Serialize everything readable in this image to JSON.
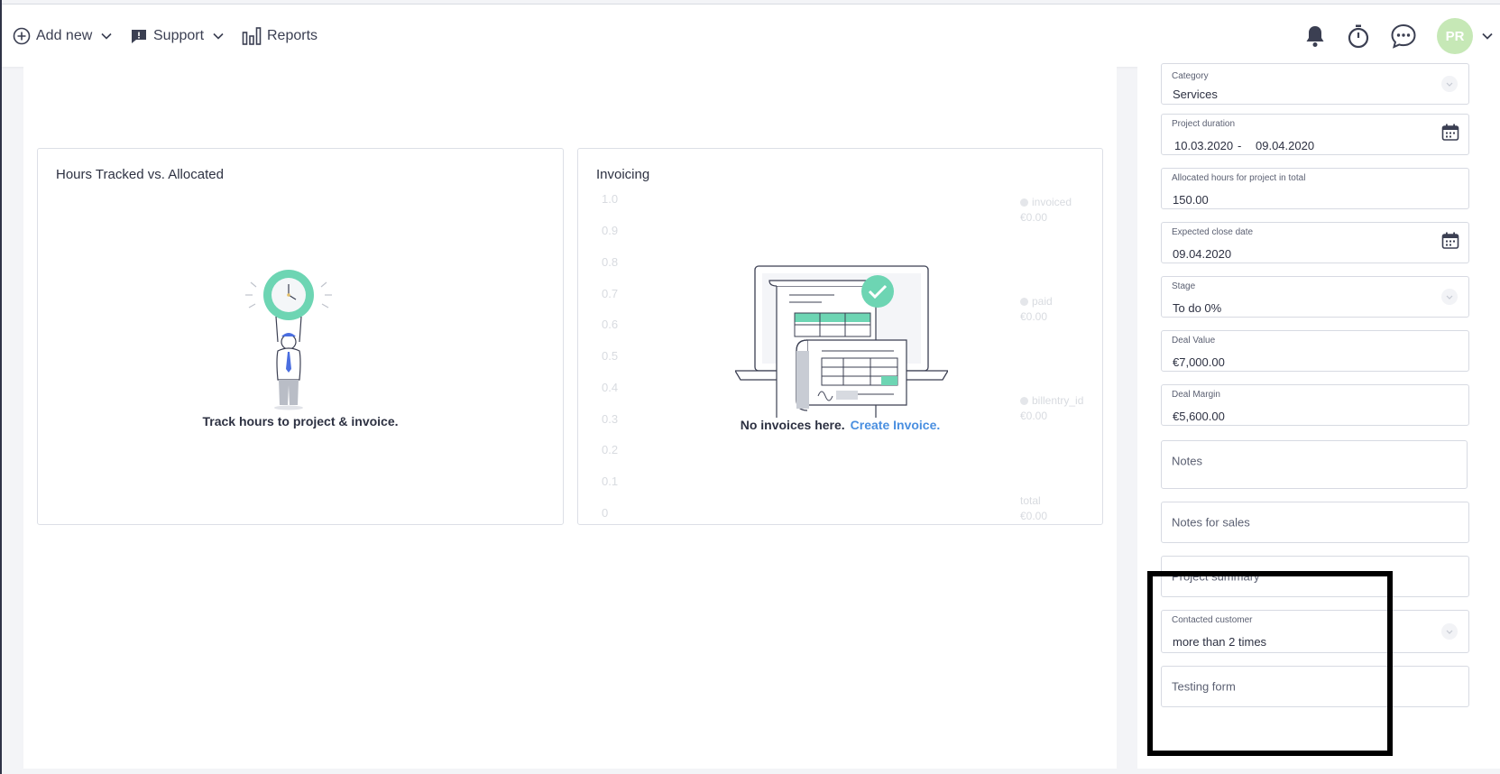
{
  "topbar": {
    "add_new": "Add new",
    "support": "Support",
    "reports": "Reports",
    "avatar_initials": "PR",
    "icons": [
      "plus-circle-icon",
      "chevron-down-icon",
      "support-icon",
      "reports-icon",
      "bell-icon",
      "stopwatch-icon",
      "chat-icon"
    ]
  },
  "cards": {
    "hours": {
      "title": "Hours Tracked vs. Allocated",
      "empty": "Track hours to project & invoice."
    },
    "invoicing": {
      "title": "Invoicing",
      "empty": "No invoices here.",
      "link": "Create Invoice.",
      "ghost_axis": [
        "1.0",
        "0.9",
        "0.8",
        "0.7",
        "0.6",
        "0.5",
        "0.4",
        "0.3",
        "0.2",
        "0.1",
        "0"
      ],
      "ghost_legend": [
        {
          "name": "invoiced",
          "value": "€0.00"
        },
        {
          "name": "paid",
          "value": "€0.00"
        },
        {
          "name": "billentry_id",
          "value": "€0.00"
        },
        {
          "name": "total",
          "value": "€0.00"
        }
      ]
    }
  },
  "sidebar": {
    "category_label": "Category",
    "category_value": "Services",
    "duration_label": "Project duration",
    "duration_start": "10.03.2020",
    "duration_sep": "-",
    "duration_end": "09.04.2020",
    "alloc_label": "Allocated hours for project in total",
    "alloc_value": "150.00",
    "close_label": "Expected close date",
    "close_value": "09.04.2020",
    "stage_label": "Stage",
    "stage_value": "To do 0%",
    "deal_value_label": "Deal Value",
    "deal_value": "€7,000.00",
    "deal_margin_label": "Deal Margin",
    "deal_margin": "€5,600.00",
    "notes": "Notes",
    "notes_sales": "Notes for sales",
    "project_summary": "Project summary",
    "contacted_label": "Contacted customer",
    "contacted_value": "more than 2 times",
    "testing_form": "Testing form"
  },
  "colors": {
    "accent": "#4a8fe0",
    "avatar_bg": "#c6e8b6",
    "illustration_green": "#6dd5b3",
    "highlight": "#000000"
  }
}
